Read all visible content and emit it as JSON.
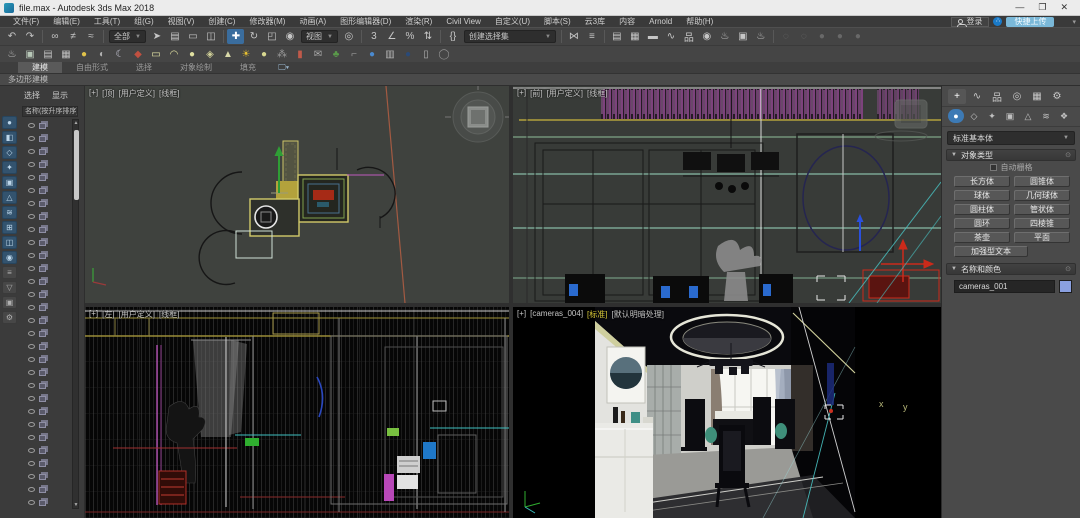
{
  "window": {
    "title": "file.max - Autodesk 3ds Max 2018",
    "minimize": "—",
    "maximize": "❐",
    "close": "✕"
  },
  "menu": {
    "items": [
      "文件(F)",
      "编辑(E)",
      "工具(T)",
      "组(G)",
      "视图(V)",
      "创建(C)",
      "修改器(M)",
      "动画(A)",
      "图形编辑器(D)",
      "渲染(R)",
      "Civil View",
      "自定义(U)",
      "脚本(S)",
      "云3库",
      "内容",
      "Arnold",
      "帮助(H)"
    ],
    "signin_label": "登录",
    "share_glyph": "∴",
    "upload_label": "快捷上传",
    "caret": "▾"
  },
  "toolbar_main": {
    "g_undo": [
      {
        "n": "undo-icon",
        "g": "↶"
      },
      {
        "n": "redo-icon",
        "g": "↷"
      }
    ],
    "g_link": [
      {
        "n": "select-link-icon",
        "g": "∞"
      },
      {
        "n": "unlink-icon",
        "g": "≠"
      },
      {
        "n": "bind-spacewarp-icon",
        "g": "≈"
      }
    ],
    "selection_filter_value": "全部",
    "g_select": [
      {
        "n": "select-object-icon",
        "g": "➤"
      },
      {
        "n": "select-by-name-icon",
        "g": "▤"
      },
      {
        "n": "region-rect-icon",
        "g": "▭"
      },
      {
        "n": "window-crossing-icon",
        "g": "◫"
      }
    ],
    "g_transform": [
      {
        "n": "select-move-icon",
        "g": "✚",
        "cls": "active"
      },
      {
        "n": "select-rotate-icon",
        "g": "↻"
      },
      {
        "n": "select-scale-icon",
        "g": "◰"
      },
      {
        "n": "select-place-icon",
        "g": "◉"
      }
    ],
    "coord_system_value": "视图",
    "g_center": [
      {
        "n": "use-center-icon",
        "g": "◎"
      }
    ],
    "g_snap": [
      {
        "n": "snap-toggle-icon",
        "g": "3"
      },
      {
        "n": "angle-snap-icon",
        "g": "∠"
      },
      {
        "n": "percent-snap-icon",
        "g": "%"
      },
      {
        "n": "spinner-snap-icon",
        "g": "⇅"
      }
    ],
    "g_named": [
      {
        "n": "edit-named-sets-icon",
        "g": "{}"
      }
    ],
    "named_sets_placeholder": "创建选择集",
    "g_mirror": [
      {
        "n": "mirror-icon",
        "g": "⋈"
      },
      {
        "n": "align-icon",
        "g": "≡"
      }
    ],
    "g_managers": [
      {
        "n": "scene-explorer-toggle-icon",
        "g": "▤"
      },
      {
        "n": "layer-explorer-icon",
        "g": "▦"
      },
      {
        "n": "ribbon-toggle-icon",
        "g": "▬"
      },
      {
        "n": "curve-editor-icon",
        "g": "∿"
      },
      {
        "n": "schematic-view-icon",
        "g": "品"
      },
      {
        "n": "material-editor-icon",
        "g": "◉"
      },
      {
        "n": "render-setup-icon",
        "g": "♨"
      },
      {
        "n": "rendered-frame-icon",
        "g": "▣"
      },
      {
        "n": "render-production-icon",
        "g": "♨"
      }
    ],
    "g_faded": [
      {
        "n": "disabled-tool-icon-1",
        "g": "◌",
        "cls": "faded"
      },
      {
        "n": "disabled-tool-icon-2",
        "g": "◌",
        "cls": "faded"
      },
      {
        "n": "disabled-tool-icon-3",
        "g": "●",
        "cls": "faded"
      },
      {
        "n": "disabled-tool-icon-4",
        "g": "●",
        "cls": "faded"
      },
      {
        "n": "disabled-tool-icon-5",
        "g": "●",
        "cls": "faded"
      }
    ]
  },
  "toolbar_secondary": {
    "icons": [
      {
        "n": "teapot-render-icon",
        "g": "♨",
        "c": "#c8c8c8"
      },
      {
        "n": "frame-window-icon",
        "g": "▣",
        "c": "#b8c8b8"
      },
      {
        "n": "render-list-icon",
        "g": "▤",
        "c": "#c0c0c0"
      },
      {
        "n": "batch-list-icon",
        "g": "▦",
        "c": "#c0c0c0"
      },
      {
        "n": "light-lister-icon",
        "g": "●",
        "c": "#e0c24a"
      },
      {
        "n": "camera-tool-icon",
        "g": "◐",
        "c": "#b0b0b0"
      },
      {
        "n": "moon-icon",
        "g": "☾",
        "c": "#c8c8d8"
      },
      {
        "n": "gift-red-icon",
        "g": "◆",
        "c": "#c05040"
      },
      {
        "n": "box-primitive-icon",
        "g": "▭",
        "c": "#e8e8a8"
      },
      {
        "n": "dome-primitive-icon",
        "g": "◠",
        "c": "#e0e0a0"
      },
      {
        "n": "sphere-primitive-icon",
        "g": "●",
        "c": "#e0e0a0"
      },
      {
        "n": "gem-primitive-icon",
        "g": "◈",
        "c": "#d0d098"
      },
      {
        "n": "cone-primitive-icon",
        "g": "▲",
        "c": "#d8d8a8"
      },
      {
        "n": "sun-icon",
        "g": "☀",
        "c": "#e8c030"
      },
      {
        "n": "sphere2-icon",
        "g": "●",
        "c": "#d8d890"
      },
      {
        "n": "scatter-icon",
        "g": "⁂",
        "c": "#9a9a9a"
      },
      {
        "n": "capsule-red-icon",
        "g": "▮",
        "c": "#c05a4a"
      },
      {
        "n": "mail-icon",
        "g": "✉",
        "c": "#aaaaaa"
      },
      {
        "n": "plant-icon",
        "g": "♣",
        "c": "#5a9a4a"
      },
      {
        "n": "spray-icon",
        "g": "⌐",
        "c": "#999999"
      },
      {
        "n": "blue-ball-icon",
        "g": "●",
        "c": "#4a8ad0"
      },
      {
        "n": "save-slot-icon",
        "g": "▥",
        "c": "#b8b8b8"
      },
      {
        "n": "dark-sphere-icon",
        "g": "●",
        "c": "#2a4a78"
      },
      {
        "n": "doc-icon",
        "g": "▯",
        "c": "#b0b0b0"
      },
      {
        "n": "about-icon",
        "g": "◯",
        "c": "#909090"
      }
    ]
  },
  "ribbon": {
    "tabs": [
      {
        "t": "建模",
        "cls": "active"
      },
      {
        "t": "自由形式"
      },
      {
        "t": "选择"
      },
      {
        "t": "对象绘制"
      },
      {
        "t": "填充"
      }
    ],
    "monitor_glyph": "🖵▾",
    "panel_label": "多边形建模"
  },
  "scene_explorer": {
    "tabs": [
      {
        "t": "选择"
      },
      {
        "t": "显示"
      }
    ],
    "column_header": "名称(按升序排序)",
    "row_count": 30,
    "strip_icons": [
      {
        "n": "display-all-icon",
        "g": "●"
      },
      {
        "n": "display-geometry-icon",
        "g": "◧"
      },
      {
        "n": "display-shapes-icon",
        "g": "◇"
      },
      {
        "n": "display-lights-icon",
        "g": "✦"
      },
      {
        "n": "display-cameras-icon",
        "g": "▣"
      },
      {
        "n": "display-helpers-icon",
        "g": "△"
      },
      {
        "n": "display-spacewarps-icon",
        "g": "≋"
      },
      {
        "n": "display-groups-icon",
        "g": "⊞"
      },
      {
        "n": "display-xrefs-icon",
        "g": "◫"
      },
      {
        "n": "display-materials-icon",
        "g": "◉"
      },
      {
        "n": "sort-icon",
        "g": "≡",
        "cls": "plain"
      },
      {
        "n": "filter-icon",
        "g": "▽",
        "cls": "plain"
      },
      {
        "n": "lock-icon",
        "g": "▣",
        "cls": "plain"
      },
      {
        "n": "settings-icon",
        "g": "⚙",
        "cls": "plain"
      }
    ],
    "scroll_up": "▲",
    "scroll_down": "▼"
  },
  "viewports": {
    "top_left": {
      "label_segments": [
        {
          "t": "[+]"
        },
        {
          "t": "[顶]"
        },
        {
          "t": "[用户定义]"
        },
        {
          "t": "[线框]"
        }
      ]
    },
    "top_right": {
      "label_segments": [
        {
          "t": "[+]"
        },
        {
          "t": "[前]"
        },
        {
          "t": "[用户定义]"
        },
        {
          "t": "[线框]"
        }
      ]
    },
    "bottom_left": {
      "label_segments": [
        {
          "t": "[+]"
        },
        {
          "t": "[左]"
        },
        {
          "t": "[用户定义]"
        },
        {
          "t": "[线框]"
        }
      ]
    },
    "bottom_right": {
      "label_segments": [
        {
          "t": "[+]"
        },
        {
          "t": "[cameras_004]"
        },
        {
          "t": "[标准]",
          "cls": "seg-yellow"
        },
        {
          "t": "[默认明暗处理]"
        }
      ],
      "axis_x": "x",
      "axis_y": "y"
    }
  },
  "command_panel": {
    "top_tabs": [
      {
        "n": "create-tab",
        "g": "+",
        "cls": "active"
      },
      {
        "n": "modify-tab",
        "g": "∿"
      },
      {
        "n": "hierarchy-tab",
        "g": "品"
      },
      {
        "n": "motion-tab",
        "g": "◎"
      },
      {
        "n": "display-tab",
        "g": "▦"
      },
      {
        "n": "utilities-tab",
        "g": "⚙"
      }
    ],
    "category_icons": [
      {
        "n": "geometry-category-icon",
        "g": "●",
        "cls": "active"
      },
      {
        "n": "shapes-category-icon",
        "g": "◇"
      },
      {
        "n": "lights-category-icon",
        "g": "✦"
      },
      {
        "n": "cameras-category-icon",
        "g": "▣"
      },
      {
        "n": "helpers-category-icon",
        "g": "△"
      },
      {
        "n": "spacewarps-category-icon",
        "g": "≋"
      },
      {
        "n": "systems-category-icon",
        "g": "❖"
      }
    ],
    "primitive_dropdown_value": "标准基本体",
    "rollout_object_type": "对象类型",
    "autogrid_label": "自动栅格",
    "object_buttons": [
      {
        "t": "长方体"
      },
      {
        "t": "圆锥体"
      },
      {
        "t": "球体"
      },
      {
        "t": "几何球体"
      },
      {
        "t": "圆柱体"
      },
      {
        "t": "管状体"
      },
      {
        "t": "圆环"
      },
      {
        "t": "四棱锥"
      },
      {
        "t": "茶壶"
      },
      {
        "t": "平面"
      },
      {
        "t": "加强型文本",
        "cls": "wide"
      }
    ],
    "rollout_name_color": "名称和颜色",
    "object_name": "cameras_001",
    "object_color": "#8aa0e0"
  }
}
